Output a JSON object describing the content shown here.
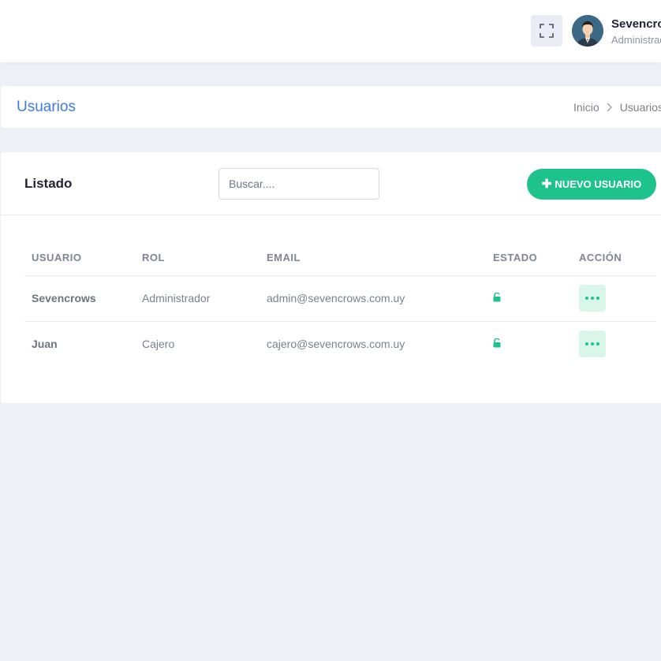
{
  "header": {
    "user_name": "Sevencrows",
    "user_role": "Administrador",
    "fullscreen_icon": "fullscreen-icon",
    "avatar_icon": "user-avatar"
  },
  "page": {
    "title": "Usuarios",
    "breadcrumb": [
      "Inicio",
      "Usuarios"
    ]
  },
  "listing": {
    "title": "Listado",
    "search_placeholder": "Buscar....",
    "add_button_label": "NUEVO USUARIO",
    "add_button_icon": "plus-icon",
    "columns": [
      "USUARIO",
      "ROL",
      "EMAIL",
      "ESTADO",
      "ACCIÓN"
    ],
    "rows": [
      {
        "usuario": "Sevencrows",
        "rol": "Administrador",
        "email": "admin@sevencrows.com.uy",
        "estado_icon": "unlock-icon"
      },
      {
        "usuario": "Juan",
        "rol": "Cajero",
        "email": "cajero@sevencrows.com.uy",
        "estado_icon": "unlock-icon"
      }
    ]
  },
  "colors": {
    "accent": "#1ec38b",
    "title_blue": "#3d7be5",
    "background": "#eef0f7"
  }
}
